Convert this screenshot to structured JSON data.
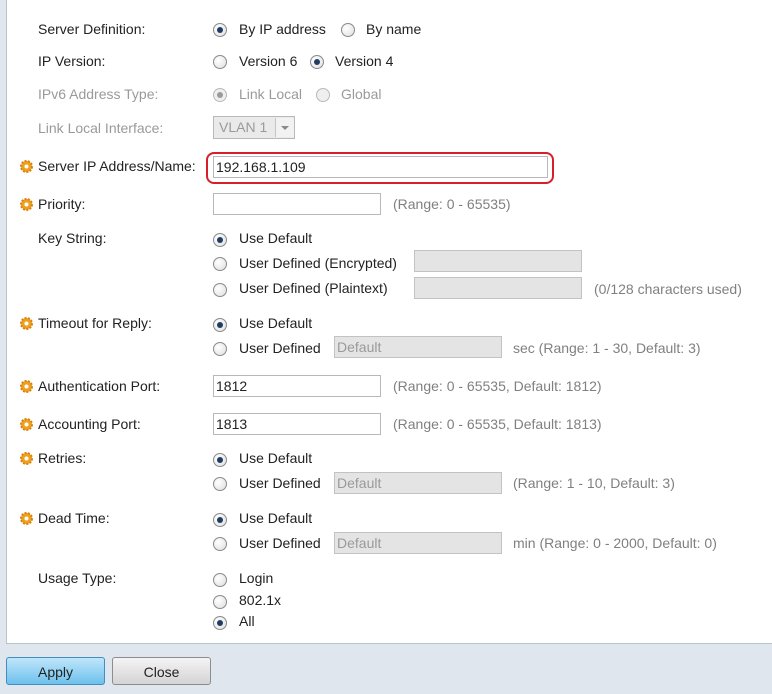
{
  "form": {
    "server_definition": {
      "label": "Server Definition:",
      "options": [
        "By IP address",
        "By name"
      ],
      "selected": "By IP address"
    },
    "ip_version": {
      "label": "IP Version:",
      "options": [
        "Version 6",
        "Version 4"
      ],
      "selected": "Version 4"
    },
    "ipv6_address_type": {
      "label": "IPv6 Address Type:",
      "options": [
        "Link Local",
        "Global"
      ],
      "selected": "Link Local",
      "disabled": true
    },
    "link_local_interface": {
      "label": "Link Local Interface:",
      "value": "VLAN 1",
      "disabled": true
    },
    "server_ip": {
      "label": "Server IP Address/Name:",
      "value": "192.168.1.109",
      "highlight_color": "#d81e2b"
    },
    "priority": {
      "label": "Priority:",
      "value": "",
      "hint": "(Range: 0 - 65535)"
    },
    "key_string": {
      "label": "Key String:",
      "options": [
        "Use Default",
        "User Defined (Encrypted)",
        "User Defined (Plaintext)"
      ],
      "selected": "Use Default",
      "plaintext_hint": "(0/128 characters used)"
    },
    "timeout": {
      "label": "Timeout for Reply:",
      "options": [
        "Use Default",
        "User Defined"
      ],
      "selected": "Use Default",
      "placeholder": "Default",
      "hint": "sec (Range: 1 - 30, Default: 3)"
    },
    "auth_port": {
      "label": "Authentication Port:",
      "value": "1812",
      "hint": "(Range: 0 - 65535, Default: 1812)"
    },
    "acct_port": {
      "label": "Accounting Port:",
      "value": "1813",
      "hint": "(Range: 0 - 65535, Default: 1813)"
    },
    "retries": {
      "label": "Retries:",
      "options": [
        "Use Default",
        "User Defined"
      ],
      "selected": "Use Default",
      "placeholder": "Default",
      "hint": "(Range: 1 - 10, Default: 3)"
    },
    "dead_time": {
      "label": "Dead Time:",
      "options": [
        "Use Default",
        "User Defined"
      ],
      "selected": "Use Default",
      "placeholder": "Default",
      "hint": "min (Range: 0 - 2000, Default: 0)"
    },
    "usage_type": {
      "label": "Usage Type:",
      "options": [
        "Login",
        "802.1x",
        "All"
      ],
      "selected": "All"
    }
  },
  "buttons": {
    "apply": "Apply",
    "close": "Close"
  },
  "icons": {
    "required": "required-gear-icon",
    "dropdown": "chevron-down-icon"
  },
  "colors": {
    "apply_button": "#7fc7ee",
    "required_icon": "#f0a020"
  }
}
